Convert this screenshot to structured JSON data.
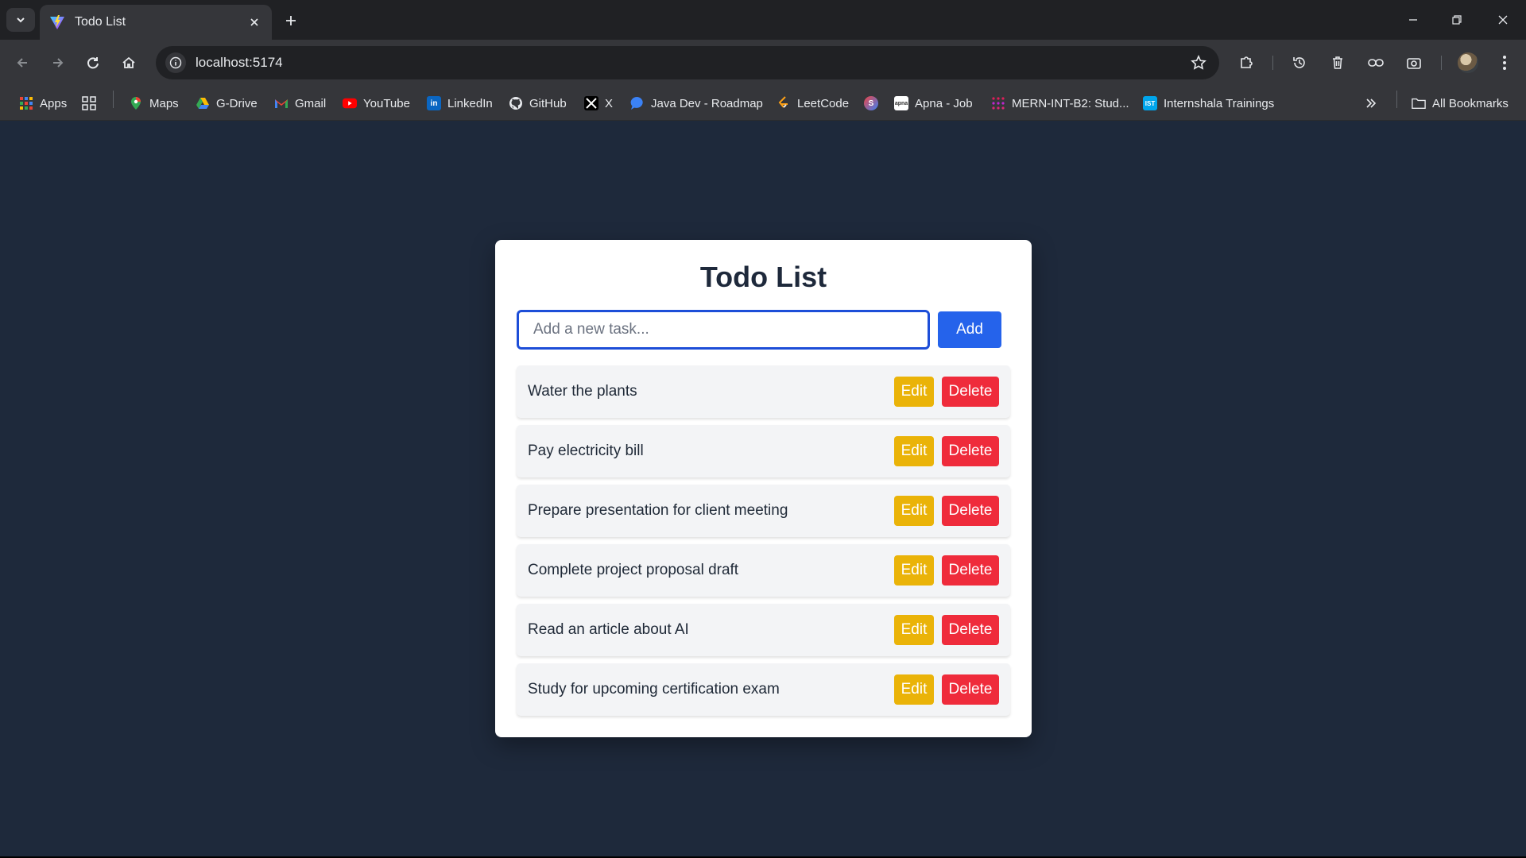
{
  "browser": {
    "tab_title": "Todo List",
    "url": "localhost:5174",
    "bookmarks_more": "All Bookmarks",
    "bookmarks": [
      {
        "label": "Apps",
        "icon": "apps-grid-icon"
      },
      {
        "label": "Maps",
        "icon": "maps-icon"
      },
      {
        "label": "G-Drive",
        "icon": "google-drive-icon"
      },
      {
        "label": "Gmail",
        "icon": "gmail-icon"
      },
      {
        "label": "YouTube",
        "icon": "youtube-icon"
      },
      {
        "label": "LinkedIn",
        "icon": "linkedin-icon"
      },
      {
        "label": "GitHub",
        "icon": "github-icon"
      },
      {
        "label": "X",
        "icon": "x-icon"
      },
      {
        "label": "Java Dev - Roadmap",
        "icon": "chat-bubble-icon"
      },
      {
        "label": "LeetCode",
        "icon": "leetcode-icon"
      },
      {
        "label": "Apna - Job",
        "icon": "apna-icon"
      },
      {
        "label": "MERN-INT-B2: Stud...",
        "icon": "slack-icon"
      },
      {
        "label": "Internshala Trainings",
        "icon": "internshala-icon"
      }
    ]
  },
  "app": {
    "title": "Todo List",
    "input_placeholder": "Add a new task...",
    "input_value": "",
    "add_label": "Add",
    "edit_label": "Edit",
    "delete_label": "Delete",
    "todos": [
      "Water the plants",
      "Pay electricity bill",
      "Prepare presentation for client meeting",
      "Complete project proposal draft",
      "Read an article about AI",
      "Study for upcoming certification exam"
    ]
  },
  "colors": {
    "page_background": "#1e293b",
    "card_background": "#ffffff",
    "title_color": "#1e293b",
    "input_border": "#1d4ed8",
    "add_button": "#2563eb",
    "edit_button": "#eab308",
    "delete_button": "#ef2b3b",
    "item_background": "#f3f4f6"
  }
}
